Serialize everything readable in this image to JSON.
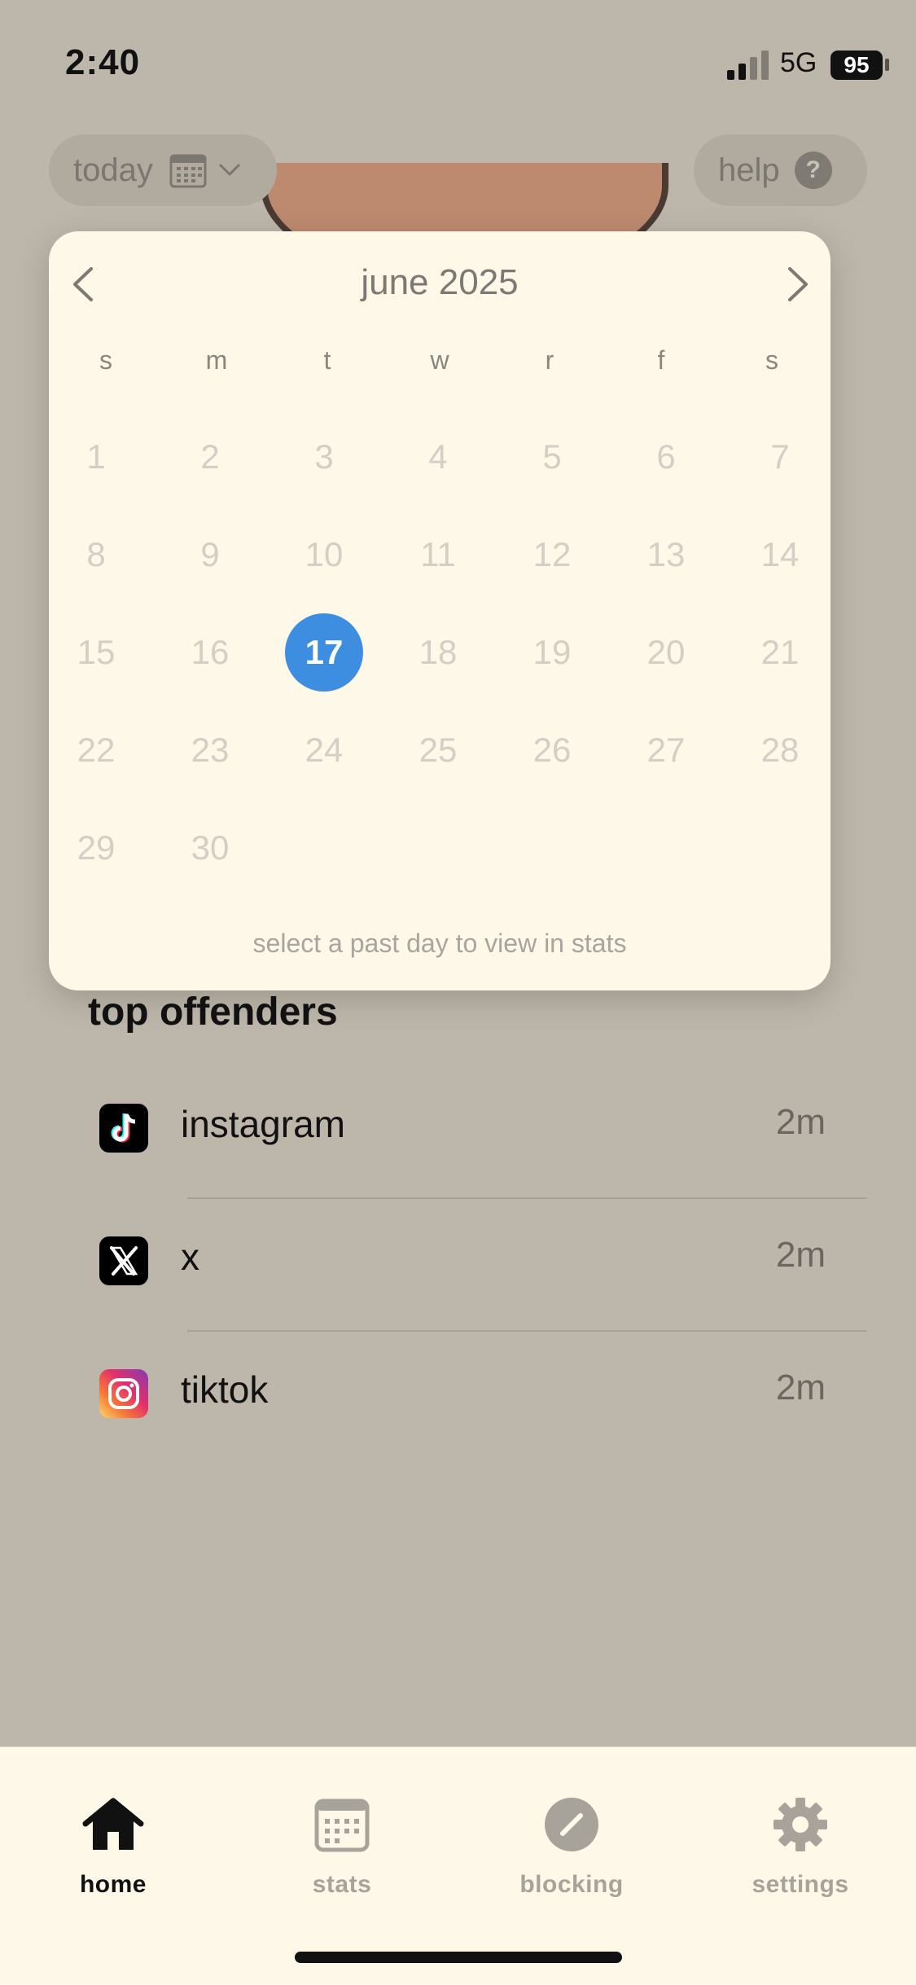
{
  "status_bar": {
    "time": "2:40",
    "network": "5G",
    "battery": "95"
  },
  "header": {
    "date_pill_label": "today",
    "help_label": "help",
    "help_icon_glyph": "?"
  },
  "calendar": {
    "title": "june 2025",
    "weekdays": [
      "s",
      "m",
      "t",
      "w",
      "r",
      "f",
      "s"
    ],
    "days": [
      "1",
      "2",
      "3",
      "4",
      "5",
      "6",
      "7",
      "8",
      "9",
      "10",
      "11",
      "12",
      "13",
      "14",
      "15",
      "16",
      "17",
      "18",
      "19",
      "20",
      "21",
      "22",
      "23",
      "24",
      "25",
      "26",
      "27",
      "28",
      "29",
      "30"
    ],
    "selected_day": "17",
    "hint": "select a past day to view in stats",
    "selected_color": "#3d8ee0"
  },
  "top_offenders": {
    "title": "top offenders",
    "items": [
      {
        "name": "instagram",
        "time": "2m",
        "icon": "tiktok-logo-icon"
      },
      {
        "name": "x",
        "time": "2m",
        "icon": "x-logo-icon"
      },
      {
        "name": "tiktok",
        "time": "2m",
        "icon": "instagram-logo-icon"
      }
    ]
  },
  "tabs": [
    {
      "label": "home",
      "icon": "home-icon",
      "active": true
    },
    {
      "label": "stats",
      "icon": "calendar-icon",
      "active": false
    },
    {
      "label": "blocking",
      "icon": "block-icon",
      "active": false
    },
    {
      "label": "settings",
      "icon": "gear-icon",
      "active": false
    }
  ]
}
